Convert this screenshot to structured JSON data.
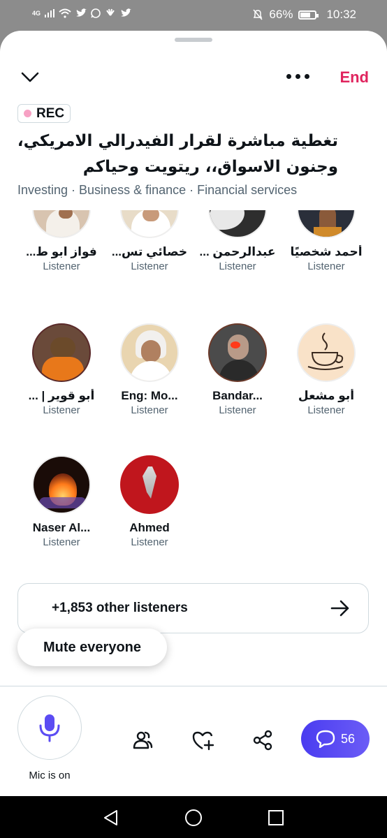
{
  "status_bar": {
    "network": "4G",
    "battery": "66%",
    "time": "10:32"
  },
  "header": {
    "end_label": "End",
    "rec_label": "REC"
  },
  "space": {
    "title": "تغطية مباشرة لقرار الفيدرالي الامريكي، وجنون الاسواق،، ريتويت وحياكم",
    "topics": "Investing · Business & finance · Financial services"
  },
  "listeners": [
    {
      "name": "أحمد شخصيًا",
      "role": "Listener",
      "avatar_color": "#2a2f3a"
    },
    {
      "name": "عبدالرحمن ...",
      "role": "Listener",
      "avatar_color": "#3a3a3a"
    },
    {
      "name": "خصائي تس...",
      "role": "Listener",
      "avatar_color": "#e8dcc8"
    },
    {
      "name": "فواز ابو ط...",
      "role": "Listener",
      "avatar_color": "#c9a58a"
    },
    {
      "name": "أبو مشعل",
      "role": "Listener",
      "avatar_color": "#f9e2c8"
    },
    {
      "name": "Bandar...",
      "role": "Listener",
      "avatar_color": "#4b4b4b"
    },
    {
      "name": "Eng: Mo...",
      "role": "Listener",
      "avatar_color": "#e9d5b0"
    },
    {
      "name": "أبو قوير | ...",
      "role": "Listener",
      "avatar_color": "#d97a1e"
    },
    {
      "name": "Naser Al...",
      "role": "Listener",
      "avatar_color": "#3a1a10"
    },
    {
      "name": "Ahmed",
      "role": "Listener",
      "avatar_color": "#c0161d"
    }
  ],
  "other_listeners_label": "+1,853 other listeners",
  "mute_everyone_label": "Mute everyone",
  "footer": {
    "mic_label": "Mic is on",
    "chat_count": "56",
    "accent": "#5b4cf3"
  }
}
